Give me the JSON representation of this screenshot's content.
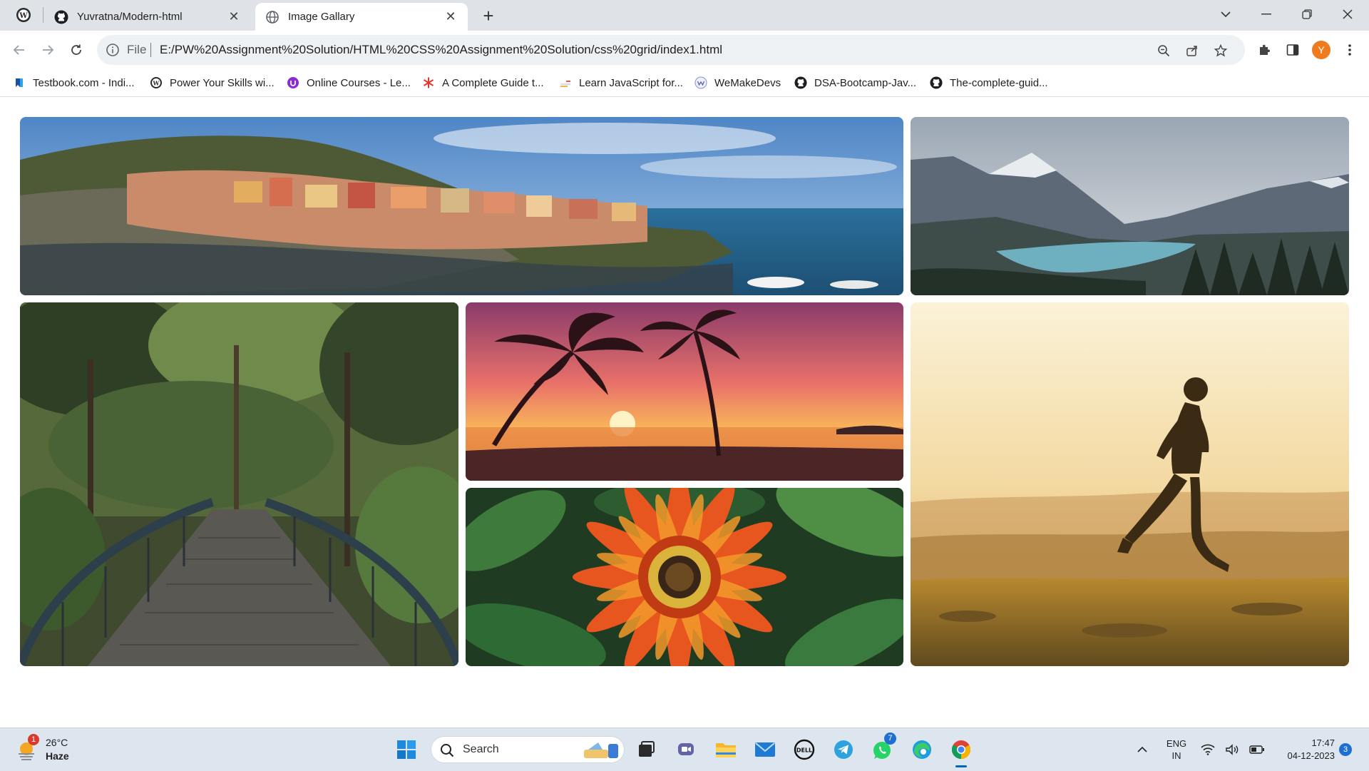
{
  "browser": {
    "tabs": [
      {
        "title": "Yuvratna/Modern-html",
        "active": false,
        "icon": "github-icon"
      },
      {
        "title": "Image Gallary",
        "active": true,
        "icon": "globe-icon"
      }
    ],
    "address": {
      "scheme_label": "File",
      "url": "E:/PW%20Assignment%20Solution/HTML%20CSS%20Assignment%20Solution/css%20grid/index1.html"
    },
    "profile_initial": "Y",
    "bookmarks": [
      {
        "label": "Testbook.com - Indi...",
        "icon": "testbook-icon"
      },
      {
        "label": "Power Your Skills wi...",
        "icon": "wordpress-icon"
      },
      {
        "label": "Online Courses - Le...",
        "icon": "udemy-icon"
      },
      {
        "label": "A Complete Guide t...",
        "icon": "asterisk-icon"
      },
      {
        "label": "Learn JavaScript for...",
        "icon": "javascript-icon"
      },
      {
        "label": "WeMakeDevs",
        "icon": "wemakedevs-icon"
      },
      {
        "label": "DSA-Bootcamp-Jav...",
        "icon": "github-icon"
      },
      {
        "label": "The-complete-guid...",
        "icon": "github-icon"
      }
    ]
  },
  "gallery": {
    "images": [
      {
        "name": "coastal-village-image",
        "subject": "coastal cliff village by the sea"
      },
      {
        "name": "mountain-lake-image",
        "subject": "mountain lake valley"
      },
      {
        "name": "forest-bridge-image",
        "subject": "bridge through a forest"
      },
      {
        "name": "palm-sunset-image",
        "subject": "palm trees at sunset"
      },
      {
        "name": "flower-image",
        "subject": "orange gazania flower"
      },
      {
        "name": "runner-image",
        "subject": "runner in a field at sunrise"
      }
    ]
  },
  "taskbar": {
    "weather": {
      "temp": "26°C",
      "condition": "Haze",
      "badge": "1"
    },
    "search_label": "Search",
    "whatsapp_badge": "7",
    "language": {
      "line1": "ENG",
      "line2": "IN"
    },
    "clock": {
      "time": "17:47",
      "date": "04-12-2023"
    },
    "notification_count": "3"
  },
  "colors": {
    "accent": "#f07b1f",
    "tab_strip": "#dfe3e8",
    "taskbar": "#dde6ee"
  }
}
